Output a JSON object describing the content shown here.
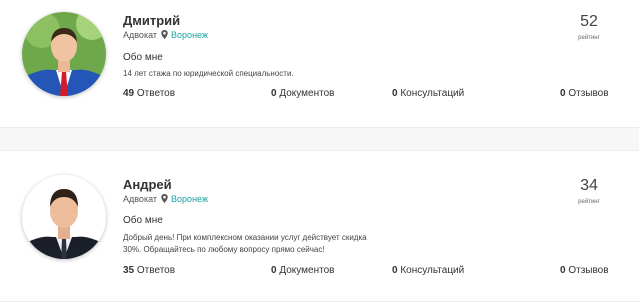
{
  "lawyers": [
    {
      "name": "Дмитрий",
      "role": "Адвокат",
      "city": "Воронеж",
      "about_title": "Обо мне",
      "about_text": "14 лет стажа по юридической специальности.",
      "stats": {
        "answers_count": "49",
        "answers_label": "Ответов",
        "documents_count": "0",
        "documents_label": "Документов",
        "consultations_count": "0",
        "consultations_label": "Консультаций",
        "reviews_count": "0",
        "reviews_label": "Отзывов"
      },
      "rating": "52",
      "rating_label": "рейтинг"
    },
    {
      "name": "Андрей",
      "role": "Адвокат",
      "city": "Воронеж",
      "about_title": "Обо мне",
      "about_text": "Добрый день! При комплексном оказании услуг действует скидка 30%. Обращайтесь по любому вопросу прямо сейчас!",
      "stats": {
        "answers_count": "35",
        "answers_label": "Ответов",
        "documents_count": "0",
        "documents_label": "Документов",
        "consultations_count": "0",
        "consultations_label": "Консультаций",
        "reviews_count": "0",
        "reviews_label": "Отзывов"
      },
      "rating": "34",
      "rating_label": "рейтинг"
    }
  ],
  "colors": {
    "city_link": "#1ba3a3",
    "card_bg": "#ffffff",
    "page_bg": "#f7f7f7"
  },
  "icons": {
    "location": "map-pin-icon"
  }
}
